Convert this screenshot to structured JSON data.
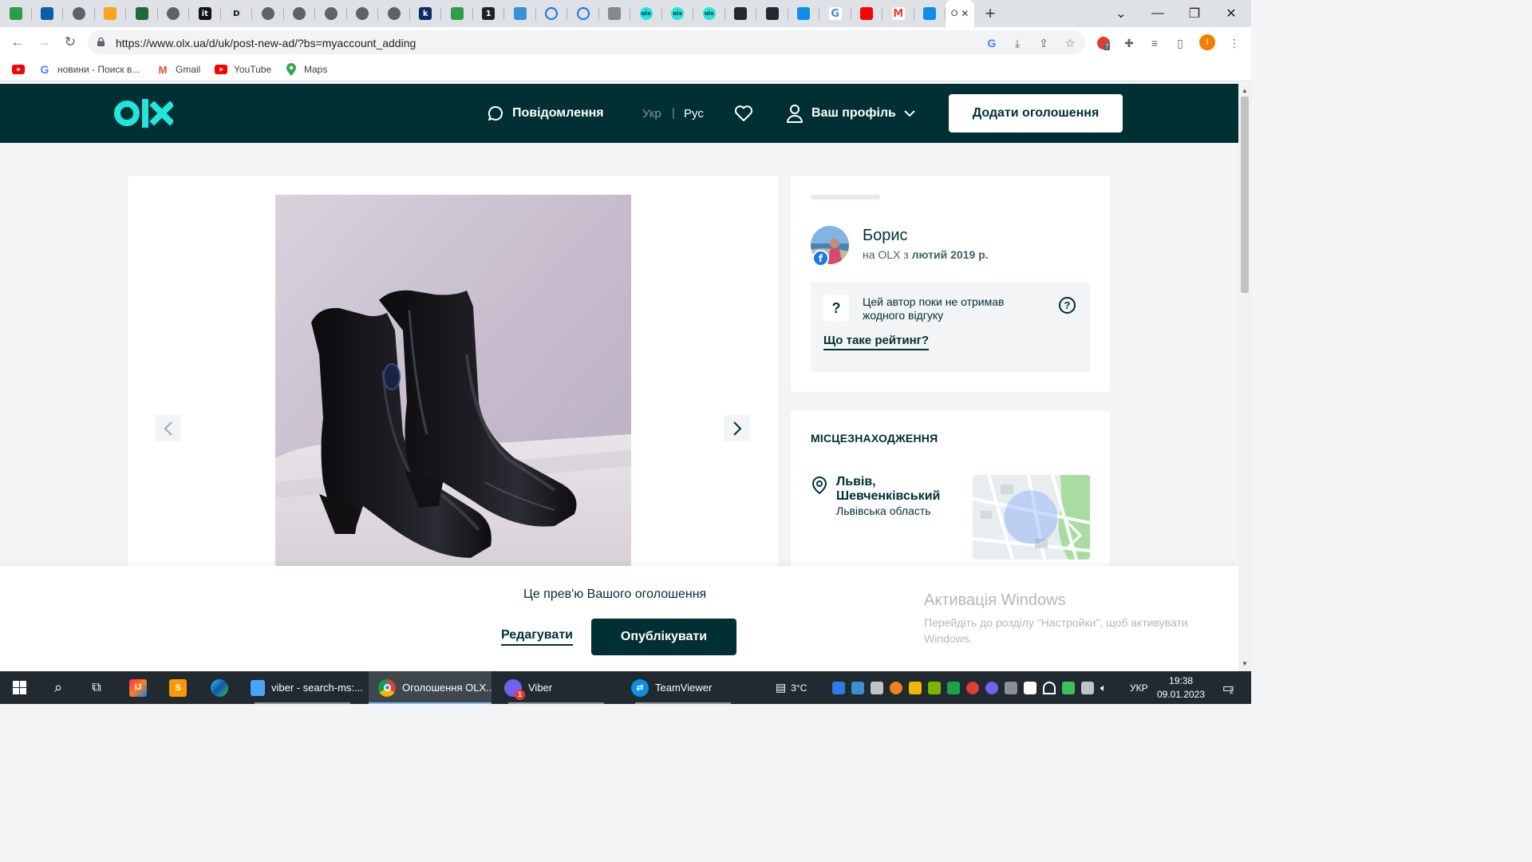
{
  "browser": {
    "tabs": [
      {
        "icon": "app-grid-icon"
      },
      {
        "icon": "grid-yellow-icon"
      },
      {
        "icon": "globe-icon"
      },
      {
        "icon": "pencil-icon"
      },
      {
        "icon": "chart-icon"
      },
      {
        "icon": "globe-icon"
      },
      {
        "icon": "it-icon",
        "glyph": "it"
      },
      {
        "icon": "d-icon",
        "glyph": "D"
      },
      {
        "icon": "globe-icon"
      },
      {
        "icon": "globe-icon"
      },
      {
        "icon": "globe-icon"
      },
      {
        "icon": "globe-icon"
      },
      {
        "icon": "globe-icon"
      },
      {
        "icon": "k-icon",
        "glyph": "k"
      },
      {
        "icon": "app-grid-icon"
      },
      {
        "icon": "one-icon",
        "glyph": "1"
      },
      {
        "icon": "book-icon"
      },
      {
        "icon": "ring-icon"
      },
      {
        "icon": "ring-icon"
      },
      {
        "icon": "clock-icon"
      },
      {
        "icon": "olx-icon"
      },
      {
        "icon": "olx-icon"
      },
      {
        "icon": "olx-icon"
      },
      {
        "icon": "github-icon"
      },
      {
        "icon": "github-icon"
      },
      {
        "icon": "teamviewer-icon"
      },
      {
        "icon": "google-icon",
        "glyph": "G"
      },
      {
        "icon": "youtube-icon"
      },
      {
        "icon": "gmail-icon",
        "glyph": "M"
      },
      {
        "icon": "teamviewer-icon"
      }
    ],
    "active_tab": {
      "label": "О",
      "close": "✕"
    },
    "new_tab": "+",
    "window": {
      "dropdown": "⌄",
      "minimize": "—",
      "restore": "❐",
      "close": "✕"
    },
    "url": "https://www.olx.ua/d/uk/post-new-ad/?bs=myaccount_adding",
    "extension_badge": "7",
    "profile_initial": "I",
    "bookmarks": [
      {
        "label": "",
        "icon": "youtube-icon"
      },
      {
        "label": "новини - Поиск в...",
        "icon": "google-icon"
      },
      {
        "label": "Gmail",
        "icon": "gmail-icon"
      },
      {
        "label": "YouTube",
        "icon": "youtube-icon"
      },
      {
        "label": "Maps",
        "icon": "maps-icon"
      }
    ]
  },
  "header": {
    "logo": "OLX",
    "messages": "Повідомлення",
    "lang_ukr": "Укр",
    "lang_sep": "|",
    "lang_rus": "Рус",
    "profile": "Ваш профіль",
    "add_ad": "Додати оголошення"
  },
  "seller": {
    "name": "Борис",
    "since_prefix": "на OLX з ",
    "since_date": "лютий 2019 р.",
    "rating_text": "Цей автор поки не отримав жодного відгуку",
    "rating_q": "?",
    "rating_help": "?",
    "rating_link": "Що таке рейтинг?",
    "fb": "f"
  },
  "location": {
    "title": "МІСЦЕЗНАХОДЖЕННЯ",
    "city": "Львів, Шевченківський",
    "region": "Львівська область"
  },
  "preview": {
    "text": "Це прев'ю Вашого оголошення",
    "edit": "Редагувати",
    "publish": "Опублікувати"
  },
  "windows_activation": {
    "title": "Активація Windows",
    "text": "Перейдіть до розділу \"Настройки\", щоб активувати Windows."
  },
  "taskbar": {
    "apps": [
      {
        "label": "viber - search-ms:...",
        "icon": "folder-icon"
      },
      {
        "label": "Оголошення OLX...",
        "icon": "chrome-icon",
        "active": true
      },
      {
        "label": "Viber",
        "icon": "viber-icon",
        "badge": "1"
      },
      {
        "label": "TeamViewer",
        "icon": "teamviewer-icon"
      }
    ],
    "weather": "3°C",
    "lang": "УКР",
    "time": "19:38",
    "date": "09.01.2023",
    "notifications": "2"
  }
}
